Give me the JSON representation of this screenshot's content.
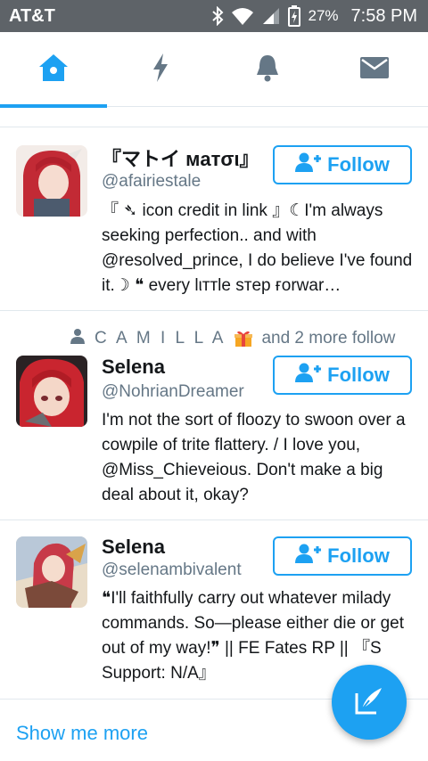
{
  "status_bar": {
    "carrier": "AT&T",
    "battery_percent": "27%",
    "time": "7:58 PM",
    "icons": [
      "bluetooth-icon",
      "wifi-icon",
      "signal-icon",
      "battery-charging-icon"
    ]
  },
  "tabs": [
    {
      "icon": "home-icon",
      "active": true
    },
    {
      "icon": "lightning-icon",
      "active": false
    },
    {
      "icon": "bell-icon",
      "active": false
    },
    {
      "icon": "mail-icon",
      "active": false
    }
  ],
  "accounts": [
    {
      "name": "『マトイ мaтσι』",
      "handle": "@afairiestale",
      "bio": "『 ➴ icon credit in link 』☾I'm always seeking perfection.. and with @resolved_prince, I do believe I've found it.☽ ❝ every lιттle ѕтep ғorwar…",
      "follow_label": "Follow"
    },
    {
      "social_context": "C A M I L L A",
      "social_suffix": "and 2 more follow",
      "name": "Selena",
      "handle": "@NohrianDreamer",
      "bio": "I'm not the sort of floozy to swoon over a cowpile of trite flattery. / I love you, @Miss_Chieveious. Don't make a big deal about it, okay?",
      "follow_label": "Follow"
    },
    {
      "name": "Selena",
      "handle": "@selenambivalent",
      "bio": "❝I'll faithfully carry out whatever milady commands. So—please either die or get out of my way!❞ || FE Fates RP || 『S Support: N/A』",
      "follow_label": "Follow"
    }
  ],
  "show_more": "Show me more",
  "compose_icon": "compose-tweet-icon",
  "colors": {
    "accent": "#1da1f2",
    "status_bar": "#5e6368",
    "secondary_text": "#657786",
    "divider": "#e1e8ed"
  }
}
